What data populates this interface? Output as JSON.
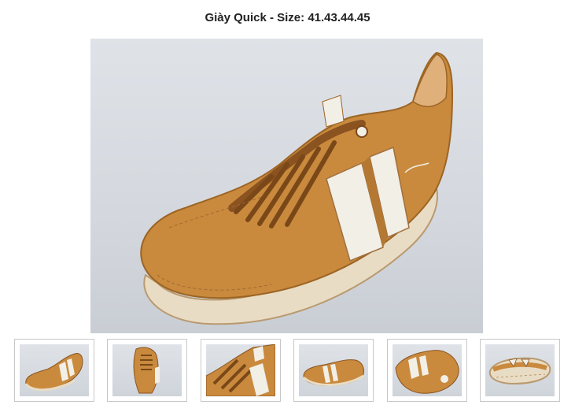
{
  "product": {
    "title": "Giày Quick - Size: 41.43.44.45"
  },
  "main_image": {
    "alt": "Giày Quick",
    "shoe_color": "#c98a3e",
    "stripe_color": "#f2efe6",
    "background_color": "#d7dbe0"
  },
  "thumbnails": [
    {
      "alt": "thumbnail-1",
      "view": "side"
    },
    {
      "alt": "thumbnail-2",
      "view": "top"
    },
    {
      "alt": "thumbnail-3",
      "view": "closeup"
    },
    {
      "alt": "thumbnail-4",
      "view": "side-left"
    },
    {
      "alt": "thumbnail-5",
      "view": "back"
    },
    {
      "alt": "thumbnail-6",
      "view": "sole"
    }
  ]
}
